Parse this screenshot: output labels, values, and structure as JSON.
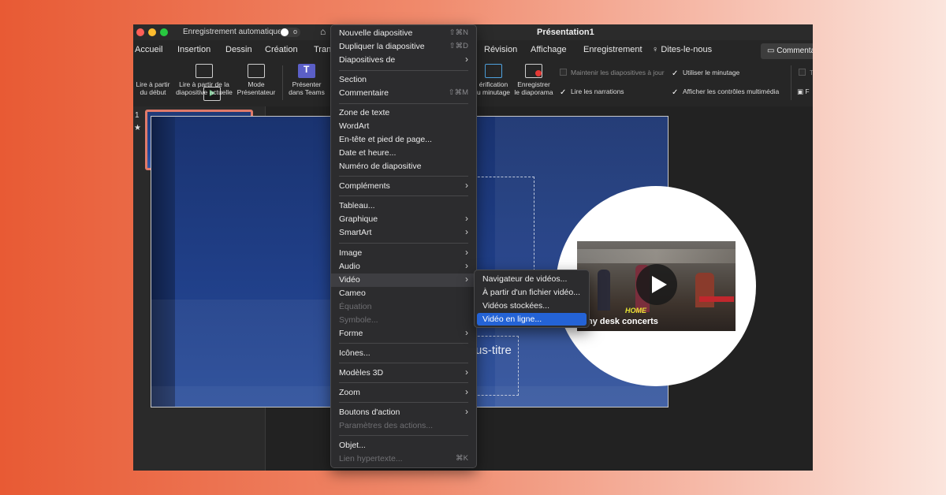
{
  "window": {
    "autosave_label": "Enregistrement automatique",
    "toggle_state": "o",
    "title": "Présentation1"
  },
  "tabs": [
    "Accueil",
    "Insertion",
    "Dessin",
    "Création",
    "Tran",
    "Révision",
    "Affichage",
    "Enregistrement",
    "Dites-le-nous"
  ],
  "comment_button": "Commenta",
  "ribbon": {
    "play_start": [
      "Lire à partir",
      "du début"
    ],
    "play_current": [
      "Lire à partir de la",
      "diapositive actuelle"
    ],
    "presenter": [
      "Mode",
      "Présentateur"
    ],
    "teams": [
      "Présenter",
      "dans Teams"
    ],
    "rehearse": [
      "érification",
      "u minutage"
    ],
    "record": [
      "Enregistrer",
      "le diaporama"
    ],
    "checks": {
      "keep_updated": "Maintenir les diapositives à jour",
      "narrations": "Lire les narrations",
      "timings": "Utiliser le minutage",
      "media_controls": "Afficher les contrôles multimédia",
      "right_1": "T",
      "right_2": "F"
    }
  },
  "thumbnails": {
    "number": "1",
    "star": "★"
  },
  "slide": {
    "subtitle_fragment": "us-titre",
    "video_home_text": "HOME",
    "video_caption": "ny desk concerts"
  },
  "menu": {
    "items": [
      {
        "label": "Nouvelle diapositive",
        "shortcut": "⇧⌘N"
      },
      {
        "label": "Dupliquer la diapositive",
        "shortcut": "⇧⌘D"
      },
      {
        "label": "Diapositives de",
        "arrow": "›"
      },
      {
        "label": "Section"
      },
      {
        "label": "Commentaire",
        "shortcut": "⇧⌘M"
      },
      {
        "label": "Zone de texte"
      },
      {
        "label": "WordArt"
      },
      {
        "label": "En-tête et pied de page..."
      },
      {
        "label": "Date et heure..."
      },
      {
        "label": "Numéro de diapositive"
      },
      {
        "label": "Compléments",
        "arrow": "›"
      },
      {
        "label": "Tableau..."
      },
      {
        "label": "Graphique",
        "arrow": "›"
      },
      {
        "label": "SmartArt",
        "arrow": "›"
      },
      {
        "label": "Image",
        "arrow": "›"
      },
      {
        "label": "Audio",
        "arrow": "›"
      },
      {
        "label": "Vidéo",
        "arrow": "›"
      },
      {
        "label": "Cameo"
      },
      {
        "label": "Équation"
      },
      {
        "label": "Symbole..."
      },
      {
        "label": "Forme",
        "arrow": "›"
      },
      {
        "label": "Icônes..."
      },
      {
        "label": "Modèles 3D",
        "arrow": "›"
      },
      {
        "label": "Zoom",
        "arrow": "›"
      },
      {
        "label": "Boutons d'action",
        "arrow": "›"
      },
      {
        "label": "Paramètres des actions..."
      },
      {
        "label": "Objet..."
      },
      {
        "label": "Lien hypertexte...",
        "shortcut": "⌘K"
      }
    ]
  },
  "submenu": {
    "items": [
      "Navigateur de vidéos...",
      "À partir d'un fichier vidéo...",
      "Vidéos stockées...",
      "Vidéo en ligne..."
    ]
  },
  "colors": {
    "accent_selection": "#2463d6",
    "slide_blue": "#203f88",
    "thumb_border": "#e07a6a"
  }
}
